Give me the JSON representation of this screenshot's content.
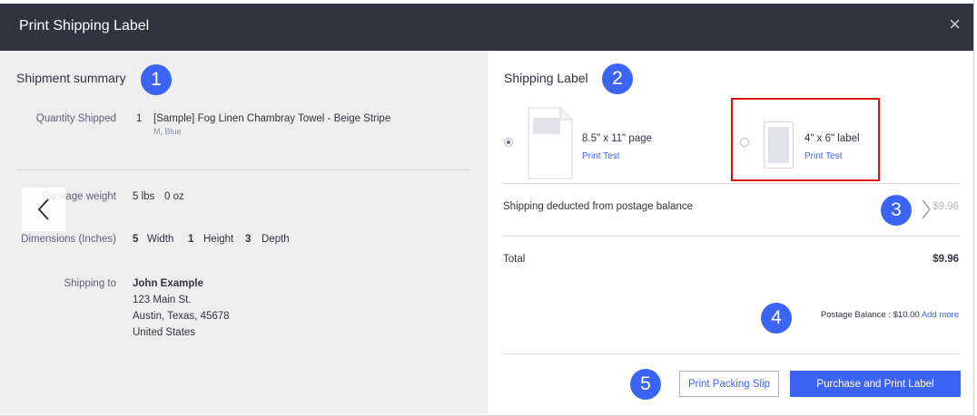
{
  "modal": {
    "title": "Print Shipping Label",
    "close_glyph": "×"
  },
  "badges": [
    "1",
    "2",
    "3",
    "4",
    "5"
  ],
  "summary": {
    "heading": "Shipment summary",
    "qty_label": "Quantity Shipped",
    "qty_value": "1",
    "item_name": "[Sample] Fog Linen Chambray Towel - Beige Stripe",
    "item_variant": "M, Blue",
    "weight_label": "Package weight",
    "weight_lbs": "5 lbs",
    "weight_oz": "0 oz",
    "dim_label": "Dimensions (Inches)",
    "dim_width_value": "5",
    "dim_width_label": "Width",
    "dim_height_value": "1",
    "dim_height_label": "Height",
    "dim_depth_value": "3",
    "dim_depth_label": "Depth",
    "ship_label": "Shipping to",
    "ship_name": "John Example",
    "ship_street": "123 Main St.",
    "ship_city": "Austin, Texas, 45678",
    "ship_country": "United States"
  },
  "label": {
    "heading": "Shipping Label",
    "option_page": "8.5\" x 11\" page",
    "option_page_link": "Print Test",
    "option_page_selected": true,
    "option_label": "4\" x 6\" label",
    "option_label_link": "Print Test",
    "option_label_selected": false
  },
  "costs": {
    "deducted_text": "Shipping deducted from postage balance",
    "deducted_amount": "$9.96",
    "total_label": "Total",
    "total_amount": "$9.96",
    "balance_text": "Postage Balance : $10.00",
    "add_more": "Add more"
  },
  "actions": {
    "packing_slip": "Print Packing Slip",
    "purchase": "Purchase and Print Label"
  },
  "colors": {
    "header_bg": "#313440",
    "accent": "#3c64f4",
    "highlight": "#e00d0d",
    "left_panel_bg": "#eeeeee"
  }
}
